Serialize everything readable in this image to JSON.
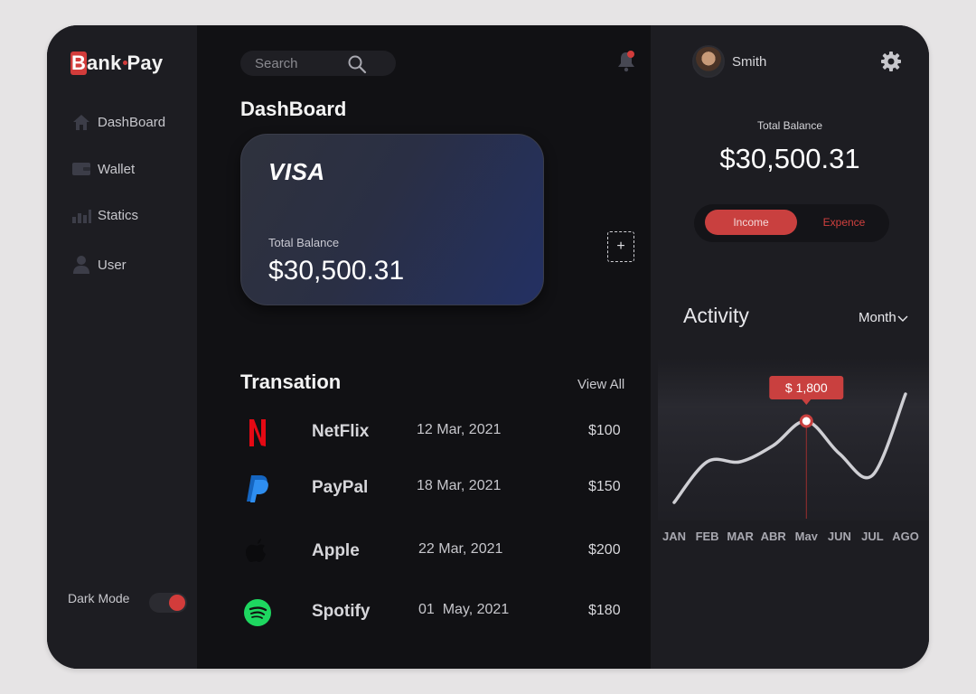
{
  "brand": {
    "letter": "B",
    "rest": "ank",
    "suffix": "Pay"
  },
  "sidebar": {
    "items": [
      {
        "label": "DashBoard",
        "icon": "home-icon"
      },
      {
        "label": "Wallet",
        "icon": "wallet-icon"
      },
      {
        "label": "Statics",
        "icon": "stats-icon"
      },
      {
        "label": "User",
        "icon": "user-icon"
      }
    ],
    "dark_mode_label": "Dark Mode",
    "dark_mode_on": true
  },
  "search": {
    "placeholder": "Search",
    "value": ""
  },
  "main": {
    "title": "DashBoard",
    "card": {
      "brand": "VISA",
      "label": "Total Balance",
      "balance": "$30,500.31"
    },
    "add_card": "+",
    "transactions_title": "Transation",
    "view_all": "View All",
    "transactions": [
      {
        "name": "NetFlix",
        "date": "12 Mar, 2021",
        "amount": "$100",
        "icon": "netflix-logo-icon"
      },
      {
        "name": "PayPal",
        "date": "18 Mar, 2021",
        "amount": "$150",
        "icon": "paypal-logo-icon"
      },
      {
        "name": "Apple",
        "date": "22 Mar, 2021",
        "amount": "$200",
        "icon": "apple-logo-icon"
      },
      {
        "name": "Spotify",
        "date": "01  May, 2021",
        "amount": "$180",
        "icon": "spotify-logo-icon"
      }
    ]
  },
  "right": {
    "user_name": "Smith",
    "total_balance_label": "Total Balance",
    "total_balance": "$30,500.31",
    "tabs": {
      "income": "Income",
      "expence": "Expence",
      "active": "income"
    },
    "activity_title": "Activity",
    "period": "Month"
  },
  "colors": {
    "accent": "#c9403f",
    "card_blue": "#233063"
  },
  "chart_data": {
    "type": "line",
    "categories": [
      "JAN",
      "FEB",
      "MAR",
      "ABR",
      "May",
      "JUN",
      "JUL",
      "AGO"
    ],
    "series": [
      {
        "values": [
          300,
          1050,
          1050,
          1350,
          1800,
          1200,
          800,
          2300
        ]
      }
    ],
    "highlight": {
      "category": "May",
      "label": "$ 1,800"
    },
    "ylim": [
      0,
      2500
    ],
    "grid": false
  }
}
